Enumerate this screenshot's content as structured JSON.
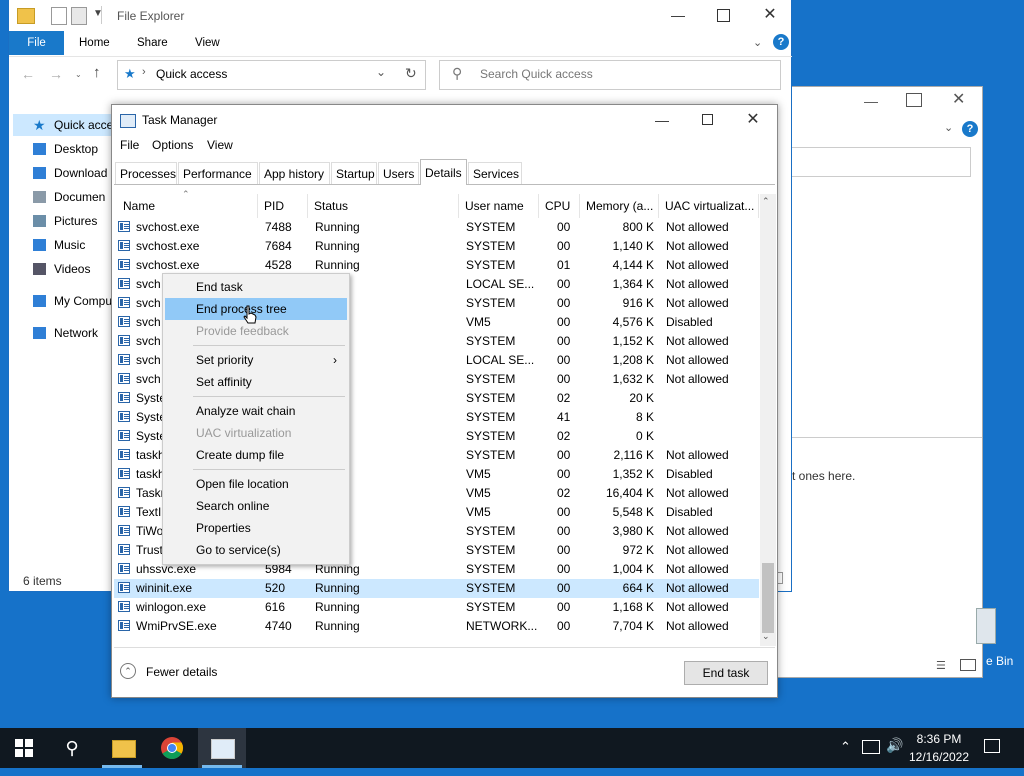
{
  "desktop": {
    "recycle_bin_label": "e Bin"
  },
  "bg_window": {
    "body_text": "t ones here.",
    "colors": {
      "bg": "#ffffff"
    }
  },
  "file_explorer": {
    "title": "File Explorer",
    "ribbon_tabs": [
      "File",
      "Home",
      "Share",
      "View"
    ],
    "address": "Quick access",
    "search_placeholder": "Search Quick access",
    "nav_items": [
      {
        "icon": "star-icon",
        "label": "Quick acce"
      },
      {
        "icon": "desktop-icon",
        "label": "Desktop"
      },
      {
        "icon": "downloads-icon",
        "label": "Download"
      },
      {
        "icon": "documents-icon",
        "label": "Documen"
      },
      {
        "icon": "pictures-icon",
        "label": "Pictures"
      },
      {
        "icon": "music-icon",
        "label": "Music"
      },
      {
        "icon": "videos-icon",
        "label": "Videos"
      },
      {
        "icon": "computer-icon",
        "label": "My Compu"
      },
      {
        "icon": "network-icon",
        "label": "Network"
      }
    ],
    "status": "6 items"
  },
  "task_manager": {
    "title": "Task Manager",
    "menu": [
      "File",
      "Options",
      "View"
    ],
    "tabs": [
      "Processes",
      "Performance",
      "App history",
      "Startup",
      "Users",
      "Details",
      "Services"
    ],
    "active_tab": "Details",
    "columns": [
      "Name",
      "PID",
      "Status",
      "User name",
      "CPU",
      "Memory (a...",
      "UAC virtualizat..."
    ],
    "rows": [
      {
        "name": "svchost.exe",
        "pid": "7488",
        "status": "Running",
        "user": "SYSTEM",
        "cpu": "00",
        "mem": "800 K",
        "uac": "Not allowed"
      },
      {
        "name": "svchost.exe",
        "pid": "7684",
        "status": "Running",
        "user": "SYSTEM",
        "cpu": "00",
        "mem": "1,140 K",
        "uac": "Not allowed"
      },
      {
        "name": "svchost.exe",
        "pid": "4528",
        "status": "Running",
        "user": "SYSTEM",
        "cpu": "01",
        "mem": "4,144 K",
        "uac": "Not allowed"
      },
      {
        "name": "svch",
        "pid": "",
        "status": "ng",
        "user": "LOCAL SE...",
        "cpu": "00",
        "mem": "1,364 K",
        "uac": "Not allowed"
      },
      {
        "name": "svch",
        "pid": "",
        "status": "ng",
        "user": "SYSTEM",
        "cpu": "00",
        "mem": "916 K",
        "uac": "Not allowed"
      },
      {
        "name": "svch",
        "pid": "",
        "status": "ng",
        "user": "VM5",
        "cpu": "00",
        "mem": "4,576 K",
        "uac": "Disabled"
      },
      {
        "name": "svch",
        "pid": "",
        "status": "ng",
        "user": "SYSTEM",
        "cpu": "00",
        "mem": "1,152 K",
        "uac": "Not allowed"
      },
      {
        "name": "svch",
        "pid": "",
        "status": "ng",
        "user": "LOCAL SE...",
        "cpu": "00",
        "mem": "1,208 K",
        "uac": "Not allowed"
      },
      {
        "name": "svch",
        "pid": "",
        "status": "ng",
        "user": "SYSTEM",
        "cpu": "00",
        "mem": "1,632 K",
        "uac": "Not allowed"
      },
      {
        "name": "Syste",
        "pid": "",
        "status": "ng",
        "user": "SYSTEM",
        "cpu": "02",
        "mem": "20 K",
        "uac": ""
      },
      {
        "name": "Syste",
        "pid": "",
        "status": "ng",
        "user": "SYSTEM",
        "cpu": "41",
        "mem": "8 K",
        "uac": ""
      },
      {
        "name": "Syste",
        "pid": "",
        "status": "ng",
        "user": "SYSTEM",
        "cpu": "02",
        "mem": "0 K",
        "uac": ""
      },
      {
        "name": "taskh",
        "pid": "",
        "status": "ng",
        "user": "SYSTEM",
        "cpu": "00",
        "mem": "2,116 K",
        "uac": "Not allowed"
      },
      {
        "name": "taskh",
        "pid": "",
        "status": "ng",
        "user": "VM5",
        "cpu": "00",
        "mem": "1,352 K",
        "uac": "Disabled"
      },
      {
        "name": "Taskn",
        "pid": "",
        "status": "ng",
        "user": "VM5",
        "cpu": "02",
        "mem": "16,404 K",
        "uac": "Not allowed"
      },
      {
        "name": "TextI",
        "pid": "",
        "status": "ng",
        "user": "VM5",
        "cpu": "00",
        "mem": "5,548 K",
        "uac": "Disabled"
      },
      {
        "name": "TiWo",
        "pid": "",
        "status": "ng",
        "user": "SYSTEM",
        "cpu": "00",
        "mem": "3,980 K",
        "uac": "Not allowed"
      },
      {
        "name": "Trust",
        "pid": "",
        "status": "ng",
        "user": "SYSTEM",
        "cpu": "00",
        "mem": "972 K",
        "uac": "Not allowed"
      },
      {
        "name": "uhssvc.exe",
        "pid": "5984",
        "status": "Running",
        "user": "SYSTEM",
        "cpu": "00",
        "mem": "1,004 K",
        "uac": "Not allowed"
      },
      {
        "name": "wininit.exe",
        "pid": "520",
        "status": "Running",
        "user": "SYSTEM",
        "cpu": "00",
        "mem": "664 K",
        "uac": "Not allowed",
        "selected": true
      },
      {
        "name": "winlogon.exe",
        "pid": "616",
        "status": "Running",
        "user": "SYSTEM",
        "cpu": "00",
        "mem": "1,168 K",
        "uac": "Not allowed"
      },
      {
        "name": "WmiPrvSE.exe",
        "pid": "4740",
        "status": "Running",
        "user": "NETWORK...",
        "cpu": "00",
        "mem": "7,704 K",
        "uac": "Not allowed"
      }
    ],
    "fewer_details": "Fewer details",
    "end_task": "End task"
  },
  "context_menu": {
    "items": [
      {
        "label": "End task"
      },
      {
        "label": "End process tree",
        "highlighted": true
      },
      {
        "label": "Provide feedback",
        "disabled": true
      },
      {
        "sep": true
      },
      {
        "label": "Set priority",
        "submenu": true
      },
      {
        "label": "Set affinity"
      },
      {
        "sep": true
      },
      {
        "label": "Analyze wait chain"
      },
      {
        "label": "UAC virtualization",
        "disabled": true
      },
      {
        "label": "Create dump file"
      },
      {
        "sep": true
      },
      {
        "label": "Open file location"
      },
      {
        "label": "Search online"
      },
      {
        "label": "Properties"
      },
      {
        "label": "Go to service(s)"
      }
    ]
  },
  "taskbar": {
    "time": "8:36 PM",
    "date": "12/16/2022"
  }
}
